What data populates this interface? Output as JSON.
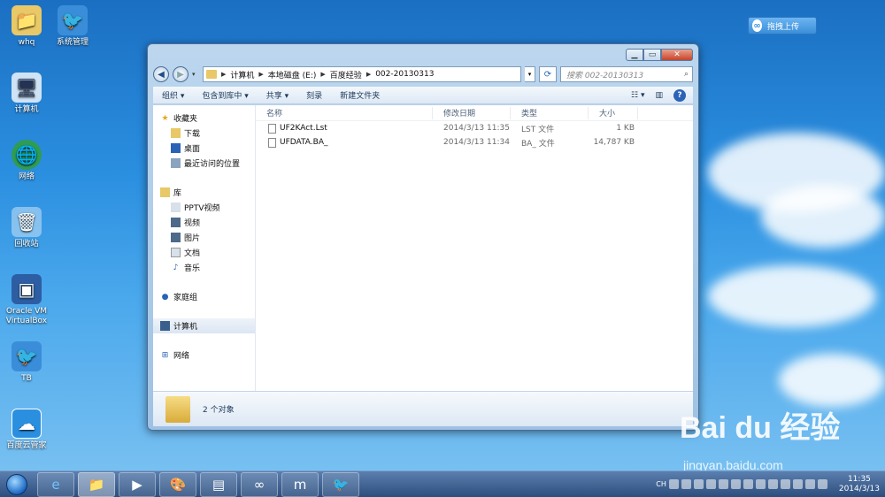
{
  "desktop": {
    "icons": [
      {
        "label": "whq",
        "icon": "folder-user-icon"
      },
      {
        "label": "系统管理",
        "icon": "bird-shortcut-icon"
      },
      {
        "label": "计算机",
        "icon": "computer-icon"
      },
      {
        "label": "网络",
        "icon": "network-globe-icon"
      },
      {
        "label": "回收站",
        "icon": "recycle-bin-icon"
      },
      {
        "label": "Oracle VM VirtualBox",
        "icon": "virtualbox-icon"
      },
      {
        "label": "TB",
        "icon": "bird-shortcut-icon"
      },
      {
        "label": "百度云管家",
        "icon": "baidu-cloud-icon"
      }
    ],
    "upload_button": "拖拽上传"
  },
  "window": {
    "address": [
      "计算机",
      "本地磁盘 (E:)",
      "百度经验",
      "002-20130313"
    ],
    "search_placeholder": "搜索 002-20130313",
    "toolbar": {
      "organize": "组织 ▾",
      "include_library": "包含到库中 ▾",
      "share": "共享 ▾",
      "burn": "刻录",
      "new_folder": "新建文件夹"
    },
    "nav": {
      "favorites": "收藏夹",
      "downloads": "下载",
      "desktop": "桌面",
      "recent": "最近访问的位置",
      "libraries": "库",
      "pptv": "PPTV视频",
      "videos": "视频",
      "pictures": "图片",
      "documents": "文档",
      "music": "音乐",
      "homegroup": "家庭组",
      "computer": "计算机",
      "network": "网络"
    },
    "columns": {
      "name": "名称",
      "date": "修改日期",
      "type": "类型",
      "size": "大小"
    },
    "files": [
      {
        "name": "UF2KAct.Lst",
        "date": "2014/3/13 11:35",
        "type": "LST 文件",
        "size": "1 KB"
      },
      {
        "name": "UFDATA.BA_",
        "date": "2014/3/13 11:34",
        "type": "BA_ 文件",
        "size": "14,787 KB"
      }
    ],
    "status": "2 个对象"
  },
  "watermark": {
    "logo": "Bai du 经验",
    "url": "jingyan.baidu.com"
  },
  "taskbar": {
    "time": "11:35",
    "date": "2014/3/13",
    "lang": "CH"
  }
}
